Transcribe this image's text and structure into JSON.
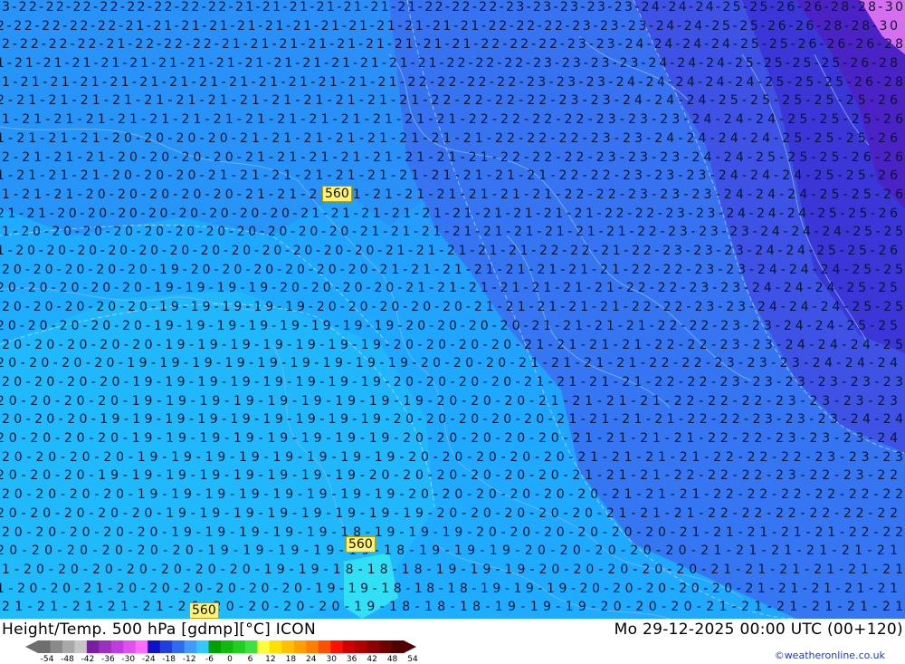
{
  "map": {
    "geopotential_labels": [
      "560",
      "560",
      "560"
    ],
    "temperature_label_rows": [
      "3 22 22 22 22 22 22 22 22 21 21 21 21 21 21 21 22 22 22 23 23 23 23 23 24 24 24 25 25 26 26 28 28 30",
      "2 22 22 22 22 21 21 21 21 21 21 21 21 21 21 21 21 21 22 22 22 23 23 23 24 24 25 25 26 26 28 28 30",
      "2 22 22 22 21 22 22 22 21 21 21 21 21 21 21 21 21 22 22 22 23 23 24 24 24 24 25 25 26 26 26 28",
      "1 21 21 21 21 21 21 21 21 21 21 21 21 21 21 21 22 22 22 23 23 23 23 24 24 24 25 25 25 25 26 28",
      "1 21 21 21 21 21 21 21 21 21 21 21 21 21 22 22 22 22 23 23 23 24 24 24 24 24 25 25 25 26 28",
      "2 21 21 21 21 21 21 21 21 21 21 21 21 21 22 22 22 22 23 23 24 24 24 25 25 25 25 25 26",
      "1 21 21 21 21 21 21 21 21 21 21 21 21 21 21 22 22 22 22 23 23 23 24 24 24 25 25 25 26",
      "1 21 21 21 20 20 20 20 21 21 21 21 21 21 21 21 22 22 22 23 23 24 24 24 24 25 25 25 26",
      "2 21 21 21 20 20 20 20 21 21 21 21 21 21 21 21 22 22 22 23 23 23 24 24 25 25 25 26 26",
      "1 21 21 21 20 20 20 21 21 21 21 21 21 21 21 21 21 21 22 22 23 23 23 24 24 24 25 25 26",
      "1 21 21 20 20 20 20 20 21 21 21 21 21 21 21 21 21 21 22 22 23 23 23 24 24 24 25 25 26",
      "21 21 20 20 20 20 20 20 20 20 21 21 21 21 21 21 21 21 21 21 22 22 23 23 24 24 24 25 25 26",
      "1 20 20 20 20 20 20 20 20 20 20 20 21 21 21 21 21 21 21 21 21 22 23 23 23 24 24 24 25 25",
      "1 20 20 20 20 20 20 20 20 20 20 20 20 21 21 21 21 21 22 22 21 22 23 23 23 24 24 25 25 26",
      "20 20 20 20 20 19 20 20 20 20 20 20 21 21 21 21 21 21 21 21 22 22 23 23 24 24 24 25 25",
      "20 20 20 20 20 19 19 19 19 20 20 20 20 21 21 21 21 21 21 21 22 22 23 23 24 24 24 25 25",
      "20 20 20 20 20 19 19 19 19 19 20 20 20 20 20 21 21 21 21 21 22 22 23 23 24 24 24 25 25",
      "20 20 20 20 20 19 19 19 19 19 19 19 19 20 20 20 20 21 21 21 21 22 22 23 23 24 24 25 25",
      "20 20 20 20 20 19 19 19 19 19 19 19 20 20 20 20 21 21 21 21 22 22 23 23 24 24 24 25",
      "20 20 20 20 19 19 19 19 19 19 19 19 19 20 20 20 21 21 21 21 22 22 23 23 23 24 24 24",
      "20 20 20 20 19 19 19 19 19 19 19 19 20 20 20 20 21 21 21 21 22 22 23 23 23 23 23 23",
      "20 20 20 20 19 19 19 19 19 19 19 19 19 20 20 20 21 21 21 21 22 22 22 23 23 23 23",
      "20 20 20 19 19 19 19 19 19 19 19 19 20 20 20 20 20 21 21 21 21 22 22 23 23 23 24 24",
      "20 20 20 20 19 19 19 19 19 19 19 19 20 20 20 20 20 21 21 21 21 22 22 23 23 23 24",
      "20 20 20 20 19 19 19 19 19 19 19 19 20 20 20 20 20 21 21 21 21 22 22 22 23 23 23",
      "20 20 20 19 19 19 19 19 19 19 19 20 20 20 20 20 20 21 21 21 22 22 22 23 22 23 22",
      "20 20 20 20 19 19 19 19 19 19 19 19 20 20 20 20 20 20 21 21 21 22 22 22 22 22 22",
      "20 20 20 20 20 19 19 19 19 19 19 19 19 20 20 20 20 20 21 21 21 22 22 22 22 22 22",
      "20 20 20 20 20 19 19 19 19 19 18 19 19 19 20 20 20 20 20 20 21 21 21 21 21 22 22",
      "20 20 20 20 20 20 19 19 19 19 19 18 19 19 19 20 20 20 20 20 21 21 21 21 21 21",
      "1 20 20 20 20 20 20 20 19 19 18 18 18 19 19 19 20 20 20 20 20 21 21 21 21 21 21",
      "1 20 20 21 20 20 20 20 20 20 19 19 18 18 18 19 19 19 20 20 20 20 20 21 21 21 21 21",
      "21 21 21 21 21 20 20 20 20 20 19 18 18 18 19 19 19 20 20 20 21 21 21 21 21 21"
    ]
  },
  "footer": {
    "title": "Height/Temp. 500 hPa [gdmp][°C] ICON",
    "date": "Mo 29-12-2025 00:00 UTC (00+120)",
    "credit": "©weatheronline.co.uk",
    "scale_ticks": [
      "-54",
      "-48",
      "-42",
      "-36",
      "-30",
      "-24",
      "-18",
      "-12",
      "-6",
      "0",
      "6",
      "12",
      "18",
      "24",
      "30",
      "36",
      "42",
      "48",
      "54"
    ],
    "scale_colors": [
      "#6e6e6e",
      "#8a8a8a",
      "#a8a8a8",
      "#c6c6c6",
      "#7a1fa2",
      "#9b2fc0",
      "#c13be0",
      "#e04ff0",
      "#ff6bff",
      "#1010c8",
      "#1f3fe0",
      "#2f6bf0",
      "#3f9bff",
      "#30c8ff",
      "#00a000",
      "#10b810",
      "#20d020",
      "#40e040",
      "#ffff40",
      "#ffe000",
      "#ffc000",
      "#ffa000",
      "#ff8000",
      "#ff5000",
      "#ff1000",
      "#d00000",
      "#b00000",
      "#900000",
      "#700000",
      "#500000"
    ]
  }
}
